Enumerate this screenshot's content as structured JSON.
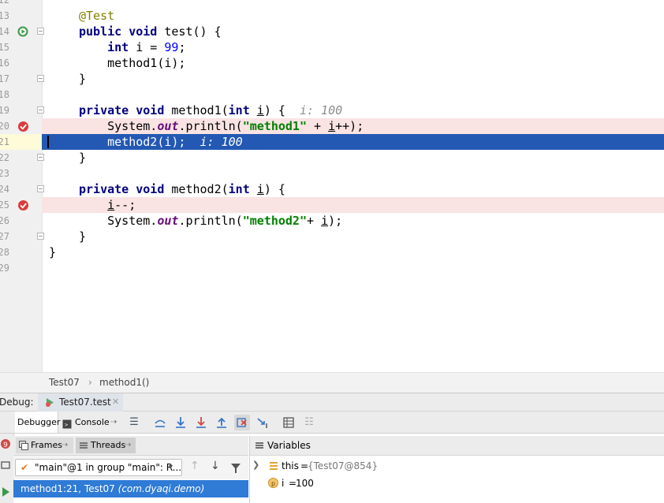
{
  "editor": {
    "lines": [
      {
        "n": "12"
      },
      {
        "n": "13",
        "tokens": [
          {
            "c": "ann",
            "t": "@Test"
          }
        ]
      },
      {
        "n": "14",
        "tokens": [
          {
            "c": "kw",
            "t": "public"
          },
          {
            "c": "",
            "t": " "
          },
          {
            "c": "kw",
            "t": "void"
          },
          {
            "c": "",
            "t": " test() {"
          }
        ]
      },
      {
        "n": "15",
        "tokens": [
          {
            "c": "",
            "t": "    "
          },
          {
            "c": "kw",
            "t": "int"
          },
          {
            "c": "",
            "t": " i = "
          },
          {
            "c": "num",
            "t": "99"
          },
          {
            "c": "",
            "t": ";"
          }
        ]
      },
      {
        "n": "16",
        "tokens": [
          {
            "c": "",
            "t": "    method1(i);"
          }
        ]
      },
      {
        "n": "17",
        "tokens": [
          {
            "c": "",
            "t": "}"
          }
        ]
      },
      {
        "n": "18",
        "tokens": []
      },
      {
        "n": "19",
        "tokens": [
          {
            "c": "kw",
            "t": "private"
          },
          {
            "c": "",
            "t": " "
          },
          {
            "c": "kw",
            "t": "void"
          },
          {
            "c": "",
            "t": " method1("
          },
          {
            "c": "kw",
            "t": "int"
          },
          {
            "c": "",
            "t": " "
          },
          {
            "c": "ul",
            "t": "i"
          },
          {
            "c": "",
            "t": ") {  "
          },
          {
            "c": "hint",
            "t": "i: 100"
          }
        ]
      },
      {
        "n": "20",
        "tokens": [
          {
            "c": "",
            "t": "    System."
          },
          {
            "c": "fld",
            "t": "out"
          },
          {
            "c": "",
            "t": ".println("
          },
          {
            "c": "str",
            "t": "\"method1\""
          },
          {
            "c": "",
            "t": " + "
          },
          {
            "c": "ul",
            "t": "i"
          },
          {
            "c": "",
            "t": "++);"
          }
        ]
      },
      {
        "n": "21",
        "tokens": [
          {
            "c": "",
            "t": "    method2(i);  "
          },
          {
            "c": "hint",
            "t": "i: 100"
          }
        ]
      },
      {
        "n": "22",
        "tokens": [
          {
            "c": "",
            "t": "}"
          }
        ]
      },
      {
        "n": "23",
        "tokens": []
      },
      {
        "n": "24",
        "tokens": [
          {
            "c": "kw",
            "t": "private"
          },
          {
            "c": "",
            "t": " "
          },
          {
            "c": "kw",
            "t": "void"
          },
          {
            "c": "",
            "t": " method2("
          },
          {
            "c": "kw",
            "t": "int"
          },
          {
            "c": "",
            "t": " "
          },
          {
            "c": "ul",
            "t": "i"
          },
          {
            "c": "",
            "t": ") {"
          }
        ]
      },
      {
        "n": "25",
        "tokens": [
          {
            "c": "",
            "t": "    "
          },
          {
            "c": "ul",
            "t": "i"
          },
          {
            "c": "",
            "t": "--;"
          }
        ]
      },
      {
        "n": "26",
        "tokens": [
          {
            "c": "",
            "t": "    System."
          },
          {
            "c": "fld",
            "t": "out"
          },
          {
            "c": "",
            "t": ".println("
          },
          {
            "c": "str",
            "t": "\"method2\""
          },
          {
            "c": "",
            "t": "+ "
          },
          {
            "c": "ul",
            "t": "i"
          },
          {
            "c": "",
            "t": ");"
          }
        ]
      },
      {
        "n": "27",
        "tokens": [
          {
            "c": "",
            "t": "}"
          }
        ]
      },
      {
        "n": "28",
        "tokens": [
          {
            "c": "",
            "t": "}"
          }
        ]
      },
      {
        "n": "29"
      }
    ]
  },
  "breadcrumb": {
    "class_name": "Test07",
    "separator": "›",
    "method_name": "method1()"
  },
  "debug_panel": {
    "label": "Debug:",
    "session_tab": "Test07.test",
    "tabs": {
      "debugger": "Debugger",
      "console": "Console"
    },
    "frames_label": "Frames",
    "threads_label": "Threads",
    "variables_label": "Variables",
    "thread_selector": "\"main\"@1 in group \"main\": R...",
    "frame": {
      "location": "method1:21, Test07",
      "package": "(com.dyaqi.demo)"
    },
    "variables": [
      {
        "name": "this",
        "value": "{Test07@854}",
        "icon": "object-icon"
      },
      {
        "name": "i",
        "value": "100",
        "icon": "primitive-icon"
      }
    ]
  },
  "colors": {
    "accent": "#2f7bd6",
    "current_line": "#2358b3",
    "breakpoint_line": "#fae3e3",
    "breakpoint": "#db3b3b"
  }
}
